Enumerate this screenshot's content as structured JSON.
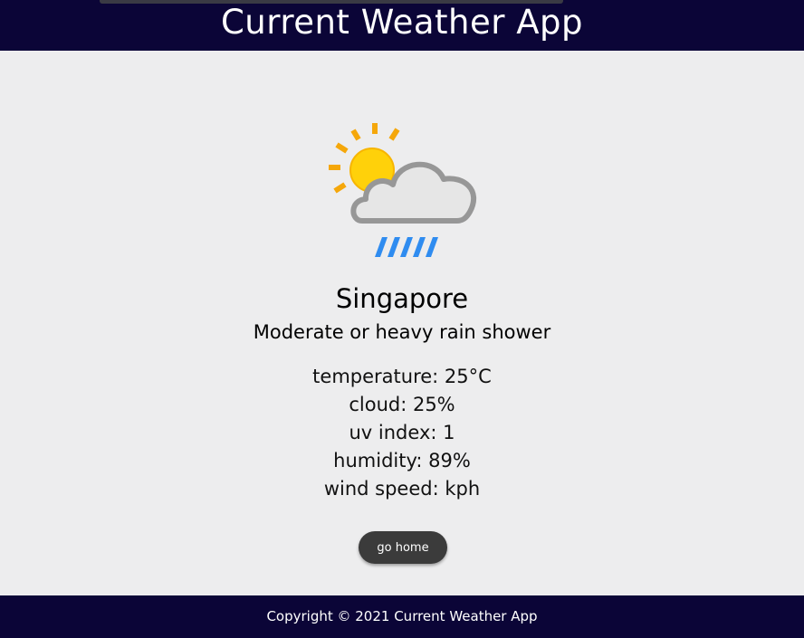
{
  "header": {
    "title": "Current Weather App"
  },
  "weather": {
    "icon": "partly-cloudy-rain-icon",
    "city": "Singapore",
    "condition": "Moderate or heavy rain shower",
    "stats": {
      "temperature": "temperature: 25°C",
      "cloud": "cloud: 25%",
      "uv_index": "uv index: 1",
      "humidity": "humidity: 89%",
      "wind_speed": "wind speed: kph"
    }
  },
  "actions": {
    "home_label": "go home"
  },
  "footer": {
    "copyright": "Copyright © 2021 Current Weather App"
  },
  "colors": {
    "header_bg": "#0b0537",
    "page_bg": "#ededee",
    "button_bg": "#3b3b3b",
    "sun": "#ffc800",
    "rain": "#2f8cf0"
  }
}
